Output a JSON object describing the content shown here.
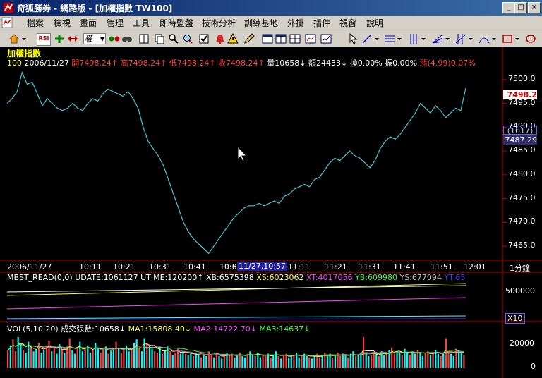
{
  "window": {
    "title": "奇狐勝券 - 網路版 - [加權指數 TW100]",
    "controls": {
      "minimize": "_",
      "restore": "□",
      "close": "×"
    }
  },
  "menu": [
    "檔案",
    "檢視",
    "畫面",
    "管理",
    "工具",
    "即時監盤",
    "技術分析",
    "訓練基地",
    "外掛",
    "插件",
    "視窗",
    "說明"
  ],
  "toolbar": {
    "period_select": "權",
    "rsi_label": "RSI"
  },
  "chart": {
    "name": "加權指數",
    "info": {
      "code": "100",
      "date": "2006/11/27",
      "open": "開7498.24",
      "high": "高7498.24",
      "low": "低7498.24",
      "close": "收7498.24",
      "volume": "量10658",
      "amount": "額24433",
      "turnover": "換0.00%",
      "amplitude": "振0.00%",
      "change": "漲(4.99)0.07%"
    },
    "price_axis": [
      "7500.0",
      "7495.0",
      "7490.0",
      "7485.0",
      "7480.0",
      "7475.0",
      "7470.0",
      "7465.0"
    ],
    "current_price": "7498.2",
    "diff_label": "(1617)",
    "diff_value": "7487.29",
    "time_axis": [
      "2006/11/27",
      "10:11",
      "10:21",
      "10:31",
      "10:41",
      "10:5",
      "11:01",
      "11:11",
      "11:21",
      "11:31",
      "11:41",
      "11:51",
      "12:01"
    ],
    "cursor_time": "11/27,10:57",
    "period": "1分鐘",
    "color_up": "#ff4040",
    "color_down": "#00ffff",
    "line_color": "#40c8d8"
  },
  "indicator1": {
    "name": "MBST_READ(0,0)",
    "udate": "UDATE:1061127",
    "utime": "UTIME:120200↑",
    "xb": "XB:6575398",
    "xs": "XS:6023062",
    "xt": "XT:4017056",
    "yb": "YB:609980",
    "ys": "YS:677094",
    "yt": "YT:65",
    "axis_value": "500000",
    "multiplier": "X10"
  },
  "volume": {
    "label": "VOL(5,10,20)",
    "count": "成交張數:10658↓",
    "ma1": "MA1:15808.40↓",
    "ma2": "MA2:14722.70↓",
    "ma3": "MA3:14637↓",
    "axis": [
      "20000",
      "0"
    ]
  },
  "chart_data": {
    "type": "line",
    "x_range": [
      "09:01",
      "13:30"
    ],
    "y_range": [
      7462.5,
      7502.5
    ],
    "series": [
      {
        "values": [
          7495.0,
          7496.0,
          7497.5,
          7501.5,
          7499.0,
          7499.5,
          7497.0,
          7494.5,
          7496.0,
          7495.0,
          7494.0,
          7493.5,
          7494.0,
          7495.0,
          7494.0,
          7493.5,
          7495.0,
          7496.0,
          7495.5,
          7497.0,
          7498.0,
          7497.5,
          7497.0,
          7496.5,
          7497.5,
          7496.0,
          7494.0,
          7490.0,
          7487.0,
          7485.5,
          7484.0,
          7482.0,
          7479.0,
          7476.0,
          7473.0,
          7470.0,
          7468.0,
          7466.5,
          7465.5,
          7464.5,
          7463.5,
          7465.0,
          7466.5,
          7468.0,
          7469.5,
          7471.0,
          7472.0,
          7473.0,
          7473.5,
          7473.5,
          7474.0,
          7473.5,
          7474.0,
          7474.5,
          7474.0,
          7475.5,
          7476.0,
          7477.0,
          7477.5,
          7478.0,
          7477.5,
          7479.0,
          7479.5,
          7481.0,
          7482.5,
          7483.5,
          7483.0,
          7484.0,
          7485.0,
          7484.0,
          7483.5,
          7482.5,
          7481.5,
          7483.0,
          7485.5,
          7487.0,
          7488.0,
          7487.5,
          7488.5,
          7490.0,
          7491.5,
          7493.0,
          7495.0,
          7494.0,
          7493.0,
          7494.5,
          7493.5,
          7492.0,
          7493.0,
          7494.0,
          7493.5,
          7498.2
        ]
      }
    ]
  },
  "volume_data": {
    "type": "bar",
    "y_range": [
      0,
      30000
    ],
    "values": [
      15000,
      19000,
      24000,
      14000,
      26000,
      21000,
      15000,
      13000,
      22000,
      18000,
      14000,
      16000,
      21000,
      13000,
      15000,
      19000,
      23000,
      14000,
      17000,
      12000,
      20000,
      16000,
      13000,
      18000,
      25000,
      15000,
      12000,
      17000,
      22000,
      14000,
      16000,
      19000,
      13000,
      15000,
      21000,
      17000,
      13000,
      16000,
      18000,
      12000,
      14000,
      17000,
      22000,
      16000,
      13000,
      15000,
      19000,
      14000,
      16000,
      21000,
      24000,
      17000,
      14000,
      25000,
      21000,
      19000,
      16000,
      14000,
      13000,
      17000,
      12000,
      15000,
      18000,
      14000,
      11000,
      13000,
      16000,
      12000,
      14000,
      12000,
      11000,
      13000,
      10000,
      12000,
      11000,
      9000,
      12000,
      10000,
      14000,
      11000,
      9000,
      12000,
      10000,
      8000,
      11000,
      13000,
      10000,
      12000,
      9000,
      11000,
      13000,
      10000,
      9000,
      12000,
      14000,
      11000,
      10000,
      13000,
      9000,
      11000,
      10000,
      12000,
      9000,
      11000,
      14000,
      10000,
      8000,
      10000,
      12000,
      9000,
      11000,
      10000,
      13000,
      9000,
      11000,
      12000,
      10000,
      9000,
      8000,
      10000,
      12000,
      9000,
      11000,
      13000,
      10000,
      12000,
      9000,
      11000,
      13000,
      10000,
      12000,
      11000,
      9000,
      12000,
      14000,
      10000,
      11000,
      13000,
      26000,
      12000,
      10000,
      11000,
      13000,
      12000,
      10000,
      14000,
      11000,
      12000,
      15000,
      17000,
      12000,
      14000,
      13000,
      11000,
      16000,
      13000,
      11000,
      14000,
      12000,
      15000,
      13000,
      10000,
      12000,
      14000,
      11000,
      13000,
      15000,
      12000,
      10000,
      13000,
      25000,
      14000,
      12000,
      10000,
      16000,
      15000,
      13000,
      10658
    ]
  }
}
